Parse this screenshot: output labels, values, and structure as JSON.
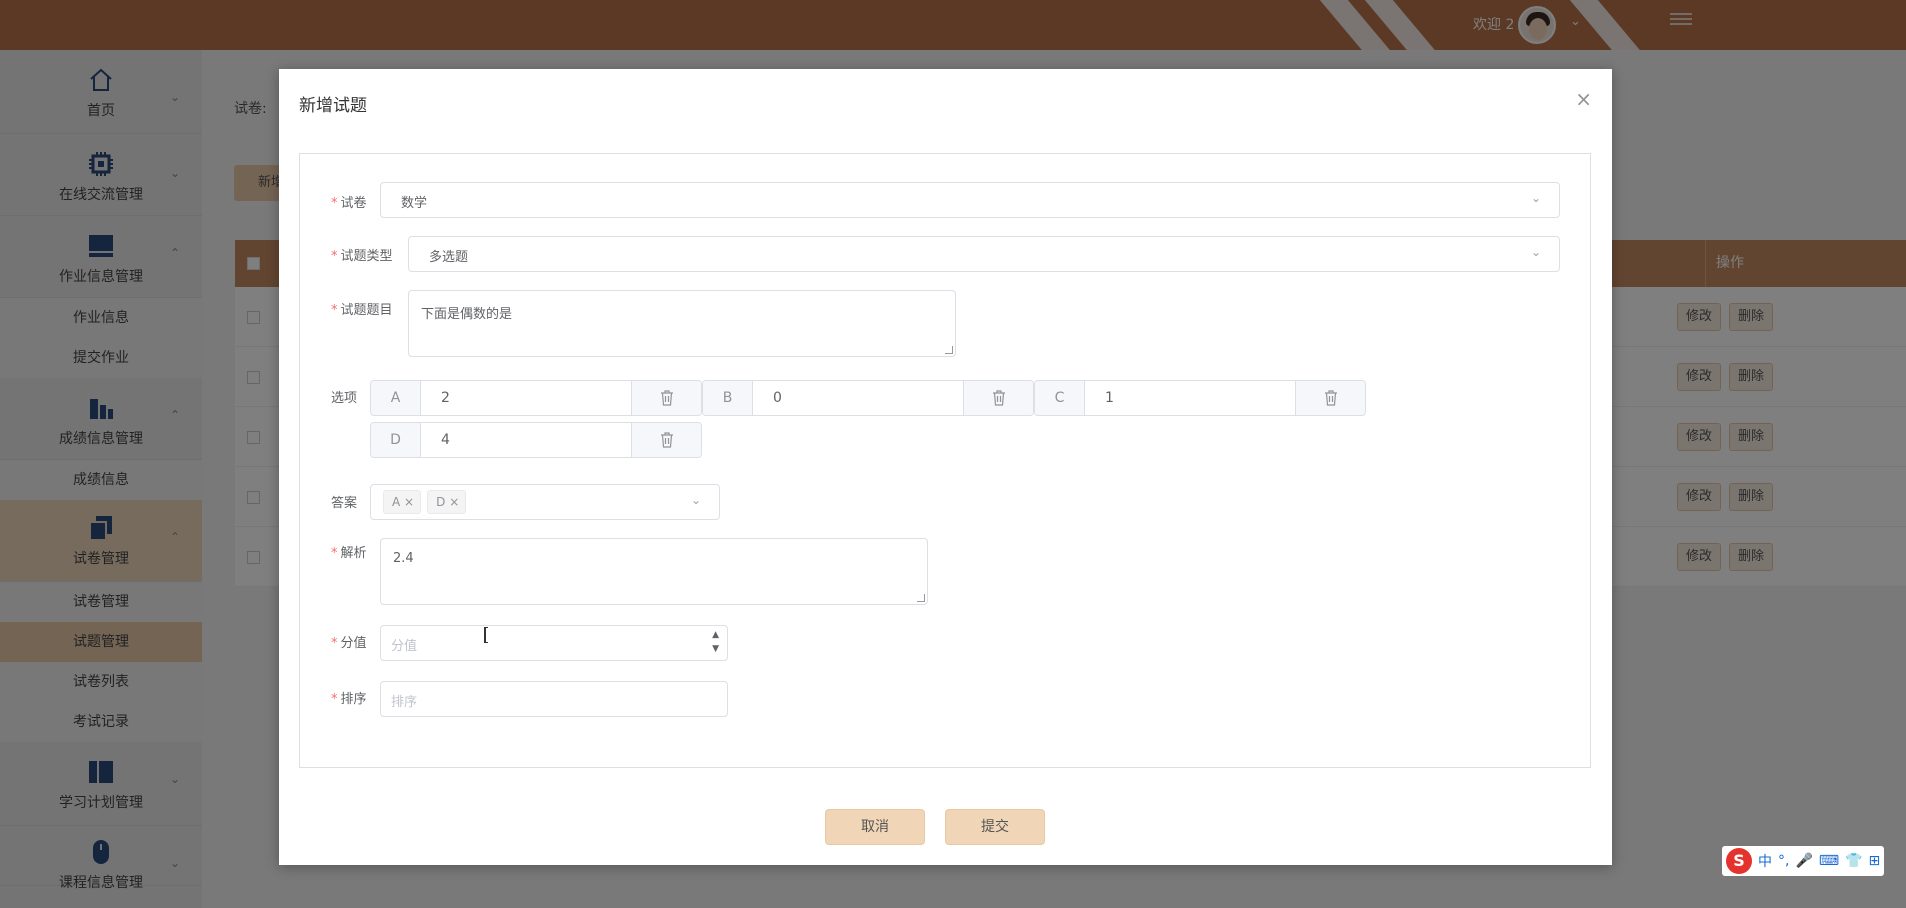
{
  "header": {
    "welcome": "欢迎 2",
    "chevron": "⌄"
  },
  "sidebar": {
    "groups": [
      {
        "label": "首页",
        "icon": "home-icon"
      },
      {
        "label": "在线交流管理",
        "icon": "chip-icon"
      },
      {
        "label": "作业信息管理",
        "icon": "monitor-icon",
        "items": [
          "作业信息",
          "提交作业"
        ]
      },
      {
        "label": "成绩信息管理",
        "icon": "buildings-icon",
        "items": [
          "成绩信息"
        ]
      },
      {
        "label": "试卷管理",
        "icon": "copy-icon",
        "items": [
          "试卷管理",
          "试题管理",
          "试卷列表",
          "考试记录"
        ]
      },
      {
        "label": "学习计划管理",
        "icon": "panels-icon"
      },
      {
        "label": "课程信息管理",
        "icon": "mouse-icon"
      }
    ]
  },
  "main": {
    "paper_label": "试卷:",
    "add_button": "新增",
    "ops_header": "操作",
    "row_actions": {
      "edit": "修改",
      "delete": "删除"
    }
  },
  "dialog": {
    "title": "新增试题",
    "close": "×",
    "fields": {
      "paper": {
        "label": "试卷",
        "value": "数学"
      },
      "type": {
        "label": "试题类型",
        "value": "多选题"
      },
      "question": {
        "label": "试题题目",
        "value": "下面是偶数的是"
      },
      "options_label": "选项",
      "options": [
        {
          "key": "A",
          "value": "2"
        },
        {
          "key": "B",
          "value": "0"
        },
        {
          "key": "C",
          "value": "1"
        },
        {
          "key": "D",
          "value": "4"
        }
      ],
      "answer": {
        "label": "答案",
        "tags": [
          "A",
          "D"
        ]
      },
      "analysis": {
        "label": "解析",
        "value": "2.4"
      },
      "score": {
        "label": "分值",
        "placeholder": "分值"
      },
      "order": {
        "label": "排序",
        "placeholder": "排序"
      }
    },
    "buttons": {
      "cancel": "取消",
      "submit": "提交"
    }
  },
  "ime": {
    "logo": "S",
    "items": [
      "中",
      "°,",
      "🎤",
      "⌨",
      "👕",
      "⊞"
    ]
  }
}
